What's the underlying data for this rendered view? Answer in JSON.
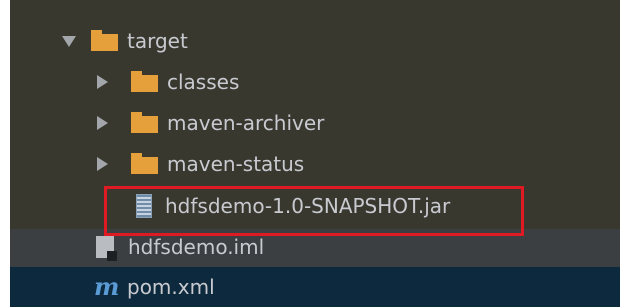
{
  "tree": {
    "items": [
      {
        "label": "target",
        "type": "folder",
        "expanded": true
      },
      {
        "label": "classes",
        "type": "folder",
        "expanded": false
      },
      {
        "label": "maven-archiver",
        "type": "folder",
        "expanded": false
      },
      {
        "label": "maven-status",
        "type": "folder",
        "expanded": false
      },
      {
        "label": "hdfsdemo-1.0-SNAPSHOT.jar",
        "type": "jar"
      },
      {
        "label": "hdfsdemo.iml",
        "type": "iml"
      },
      {
        "label": "pom.xml",
        "type": "maven"
      }
    ],
    "maven_icon_letter": "m"
  },
  "colors": {
    "folder": "#e6a03b",
    "text": "#c8cad0",
    "highlight_border": "#e01a22",
    "selected_row": "#0d293e"
  }
}
